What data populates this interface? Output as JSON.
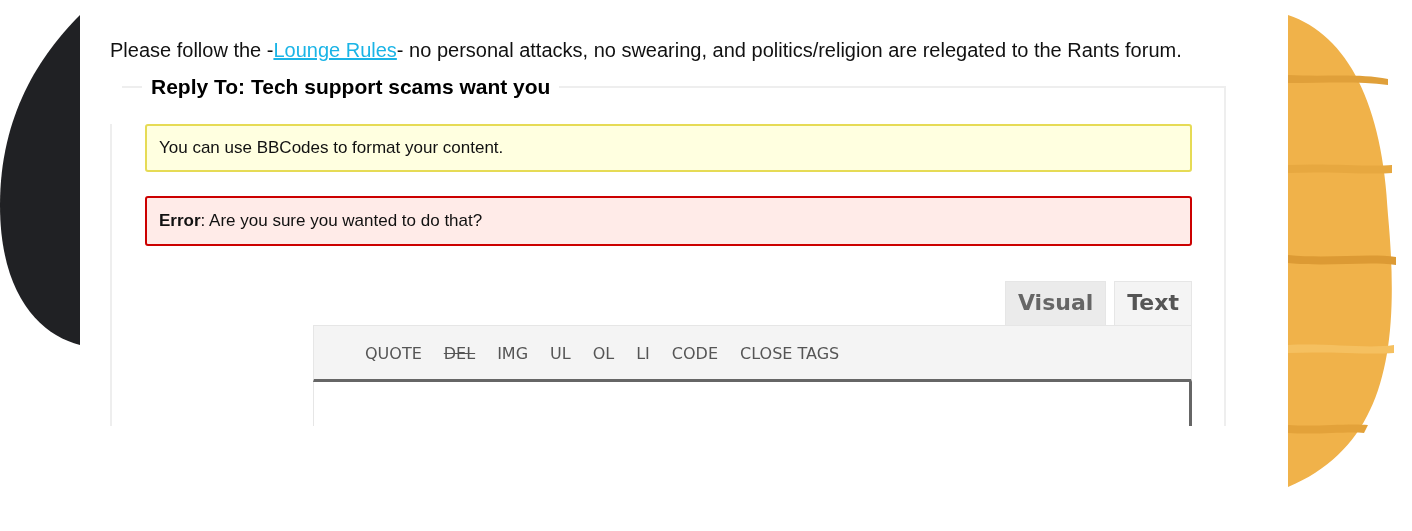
{
  "notice": {
    "before": "Please follow the -",
    "link": "Lounge Rules",
    "after": "- no personal attacks, no swearing, and politics/religion are relegated to the Rants forum."
  },
  "reply_form": {
    "legend": "Reply To: Tech support scams want you",
    "info": "You can use BBCodes to format your content.",
    "error": {
      "label": "Error",
      "message": ": Are you sure you wanted to do that?"
    },
    "editor_tabs": [
      {
        "label": "Visual",
        "selected": false
      },
      {
        "label": "Text",
        "selected": true
      }
    ],
    "toolbar": [
      {
        "label": "QUOTE",
        "kind": "plain"
      },
      {
        "label": "DEL",
        "kind": "strike"
      },
      {
        "label": "IMG",
        "kind": "plain"
      },
      {
        "label": "UL",
        "kind": "plain"
      },
      {
        "label": "OL",
        "kind": "plain"
      },
      {
        "label": "LI",
        "kind": "plain"
      },
      {
        "label": "CODE",
        "kind": "plain"
      },
      {
        "label": "CLOSE TAGS",
        "kind": "plain"
      }
    ]
  }
}
